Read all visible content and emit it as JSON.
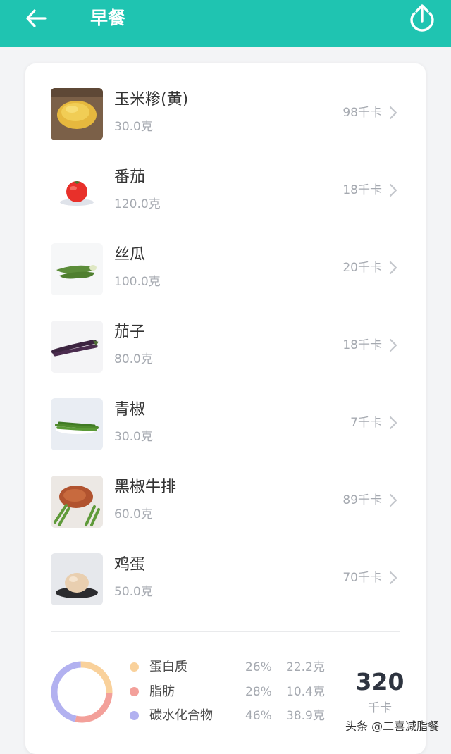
{
  "header": {
    "title": "早餐",
    "back_icon": "arrow-left-icon",
    "share_icon": "upload-share-icon",
    "bg_color": "#1fc4b1"
  },
  "foods": [
    {
      "name": "玉米糁(黄)",
      "weight": "30.0克",
      "calories": "98千卡",
      "image": "cornmeal"
    },
    {
      "name": "番茄",
      "weight": "120.0克",
      "calories": "18千卡",
      "image": "tomato"
    },
    {
      "name": "丝瓜",
      "weight": "100.0克",
      "calories": "20千卡",
      "image": "luffa"
    },
    {
      "name": "茄子",
      "weight": "80.0克",
      "calories": "18千卡",
      "image": "eggplant"
    },
    {
      "name": "青椒",
      "weight": "30.0克",
      "calories": "7千卡",
      "image": "green-pepper"
    },
    {
      "name": "黑椒牛排",
      "weight": "60.0克",
      "calories": "89千卡",
      "image": "steak"
    },
    {
      "name": "鸡蛋",
      "weight": "50.0克",
      "calories": "70千卡",
      "image": "egg"
    }
  ],
  "nutrition": {
    "items": [
      {
        "label": "蛋白质",
        "percent": "26%",
        "amount": "22.2克",
        "color": "#f9d19b",
        "fraction": 0.26
      },
      {
        "label": "脂肪",
        "percent": "28%",
        "amount": "10.4克",
        "color": "#f3a09a",
        "fraction": 0.28
      },
      {
        "label": "碳水化合物",
        "percent": "46%",
        "amount": "38.9克",
        "color": "#b2b1f0",
        "fraction": 0.46
      }
    ],
    "total_value": "320",
    "total_unit": "千卡"
  },
  "watermark": "头条 @二喜减脂餐"
}
